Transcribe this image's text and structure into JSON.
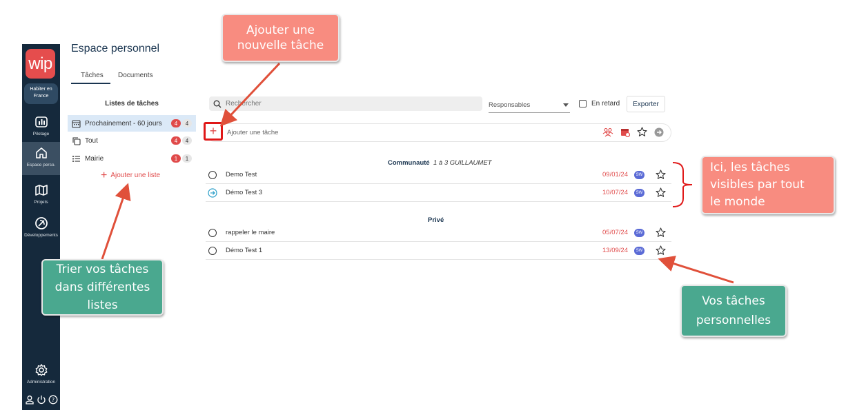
{
  "nav": {
    "logo": "wip",
    "region": [
      "Habiter en",
      "France"
    ],
    "items": [
      {
        "label": "Pilotage"
      },
      {
        "label": "Espace perso."
      },
      {
        "label": "Projets"
      },
      {
        "label": "Développements"
      },
      {
        "label": "Administration"
      }
    ]
  },
  "header": {
    "title": "Espace personnel"
  },
  "tabs": [
    {
      "label": "Tâches"
    },
    {
      "label": "Documents"
    }
  ],
  "lists": {
    "title": "Listes de tâches",
    "items": [
      {
        "label": "Prochainement - 60 jours",
        "late": "4",
        "total": "4"
      },
      {
        "label": "Tout",
        "late": "4",
        "total": "4"
      },
      {
        "label": "Mairie",
        "late": "1",
        "total": "1"
      }
    ],
    "add_label": "Ajouter une liste"
  },
  "toolbar": {
    "search_placeholder": "Rechercher",
    "responsables": "Responsables",
    "late_label": "En retard",
    "export_label": "Exporter"
  },
  "add_task": {
    "placeholder": "Ajouter une tâche"
  },
  "groups": [
    {
      "title": "Communauté",
      "subtitle": "1 à 3 GUILLAUMET",
      "tasks": [
        {
          "name": "Demo Test",
          "date": "09/01/24",
          "assignee": "SW"
        },
        {
          "name": "Démo Test 3",
          "date": "10/07/24",
          "assignee": "SW"
        }
      ]
    },
    {
      "title": "Privé",
      "tasks": [
        {
          "name": "rappeler le maire",
          "date": "05/07/24",
          "assignee": "SW"
        },
        {
          "name": "Démo Test 1",
          "date": "13/09/24",
          "assignee": "SW"
        }
      ]
    }
  ],
  "annotations": {
    "add_task": [
      "Ajouter une",
      "nouvelle tâche"
    ],
    "visible": [
      "Ici, les tâches",
      "visibles par tout",
      "le monde"
    ],
    "lists": [
      "Trier vos tâches",
      "dans différentes",
      "listes"
    ],
    "personal": [
      "Vos tâches",
      "personnelles"
    ]
  },
  "colors": {
    "nav_bg": "#15293c",
    "accent": "#e04a4a",
    "callout_salmon": "#f88c80",
    "callout_teal": "#4aa88f",
    "assignee": "#5b6bd6"
  }
}
